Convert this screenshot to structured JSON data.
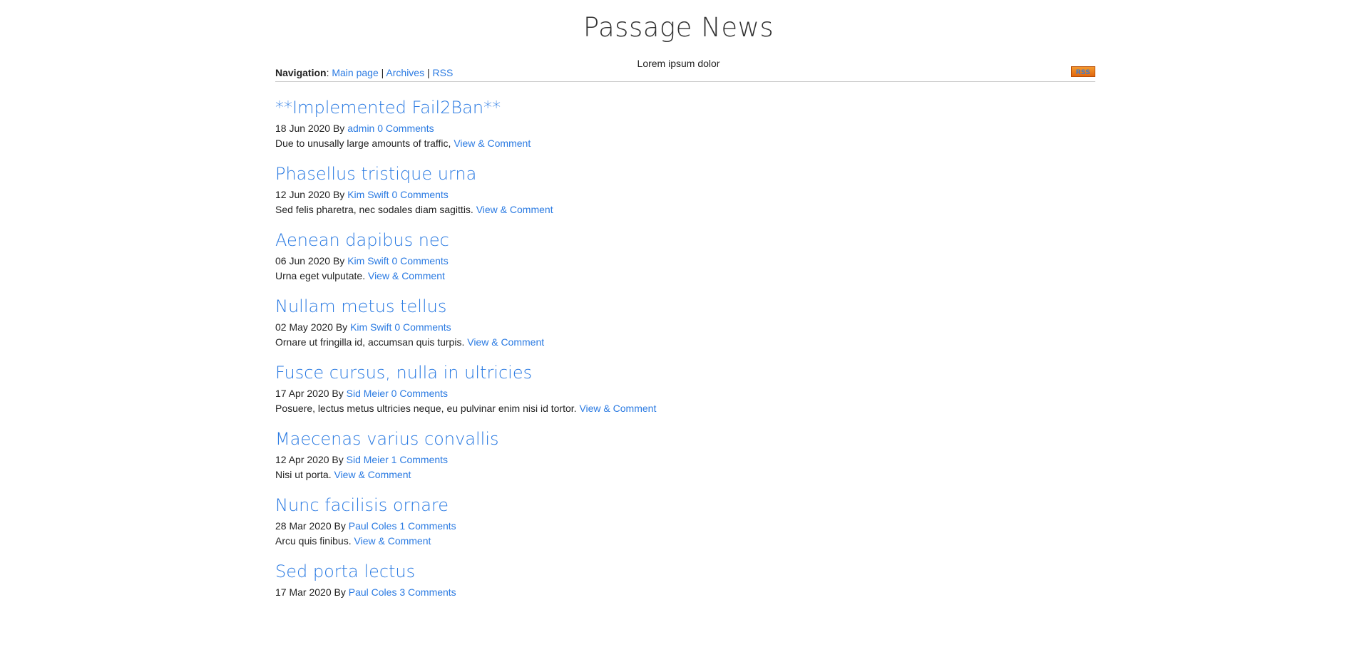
{
  "site": {
    "title": "Passage News",
    "subtitle": "Lorem ipsum dolor"
  },
  "nav": {
    "label": "Navigation",
    "colon": ":",
    "items": [
      "Main page",
      "Archives",
      "RSS"
    ],
    "separator": "|",
    "rss_badge": "RSS"
  },
  "posts": [
    {
      "title": "**Implemented Fail2Ban**",
      "date": "18 Jun 2020",
      "by": "By",
      "author": "admin",
      "comments": "0 Comments",
      "summary": "Due to unusally large amounts of traffic,",
      "link": "View & Comment"
    },
    {
      "title": "Phasellus tristique urna",
      "date": "12 Jun 2020",
      "by": "By",
      "author": "Kim Swift",
      "comments": "0 Comments",
      "summary": "Sed felis pharetra, nec sodales diam sagittis.",
      "link": "View & Comment"
    },
    {
      "title": "Aenean dapibus nec",
      "date": "06 Jun 2020",
      "by": "By",
      "author": "Kim Swift",
      "comments": "0 Comments",
      "summary": "Urna eget vulputate.",
      "link": "View & Comment"
    },
    {
      "title": "Nullam metus tellus",
      "date": "02 May 2020",
      "by": "By",
      "author": "Kim Swift",
      "comments": "0 Comments",
      "summary": "Ornare ut fringilla id, accumsan quis turpis.",
      "link": "View & Comment"
    },
    {
      "title": "Fusce cursus, nulla in ultricies",
      "date": "17 Apr 2020",
      "by": "By",
      "author": "Sid Meier",
      "comments": "0 Comments",
      "summary": "Posuere, lectus metus ultricies neque, eu pulvinar enim nisi id tortor.",
      "link": "View & Comment"
    },
    {
      "title": "Maecenas varius convallis",
      "date": "12 Apr 2020",
      "by": "By",
      "author": "Sid Meier",
      "comments": "1 Comments",
      "summary": "Nisi ut porta.",
      "link": "View & Comment"
    },
    {
      "title": "Nunc facilisis ornare",
      "date": "28 Mar 2020",
      "by": "By",
      "author": "Paul Coles",
      "comments": "1 Comments",
      "summary": "Arcu quis finibus.",
      "link": "View & Comment"
    },
    {
      "title": "Sed porta lectus",
      "date": "17 Mar 2020",
      "by": "By",
      "author": "Paul Coles",
      "comments": "3 Comments",
      "summary": "",
      "link": ""
    }
  ]
}
